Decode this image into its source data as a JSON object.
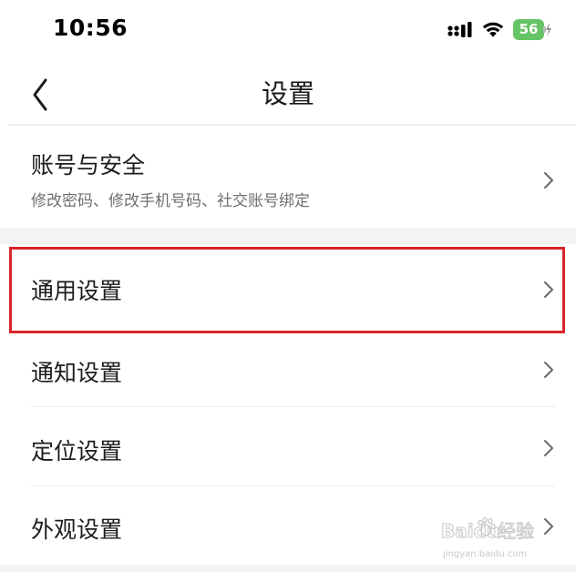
{
  "status_bar": {
    "time": "10:56",
    "battery_level": "56",
    "icons": [
      "signal-icon",
      "wifi-icon",
      "battery-icon",
      "charging-bolt-icon"
    ]
  },
  "nav": {
    "title": "设置",
    "back_icon": "chevron-left-icon"
  },
  "settings": [
    {
      "id": "account-security",
      "title": "账号与安全",
      "subtitle": "修改密码、修改手机号码、社交账号绑定"
    },
    {
      "id": "general",
      "title": "通用设置",
      "highlighted": true
    },
    {
      "id": "notification",
      "title": "通知设置"
    },
    {
      "id": "location",
      "title": "定位设置"
    },
    {
      "id": "appearance",
      "title": "外观设置"
    }
  ],
  "watermark": {
    "brand": "Baidu",
    "cn": "经验",
    "url": "jingyan.baidu.com"
  },
  "colors": {
    "highlight": "#d7262a",
    "battery": "#65c466",
    "section_gap": "#f4f4f4"
  }
}
